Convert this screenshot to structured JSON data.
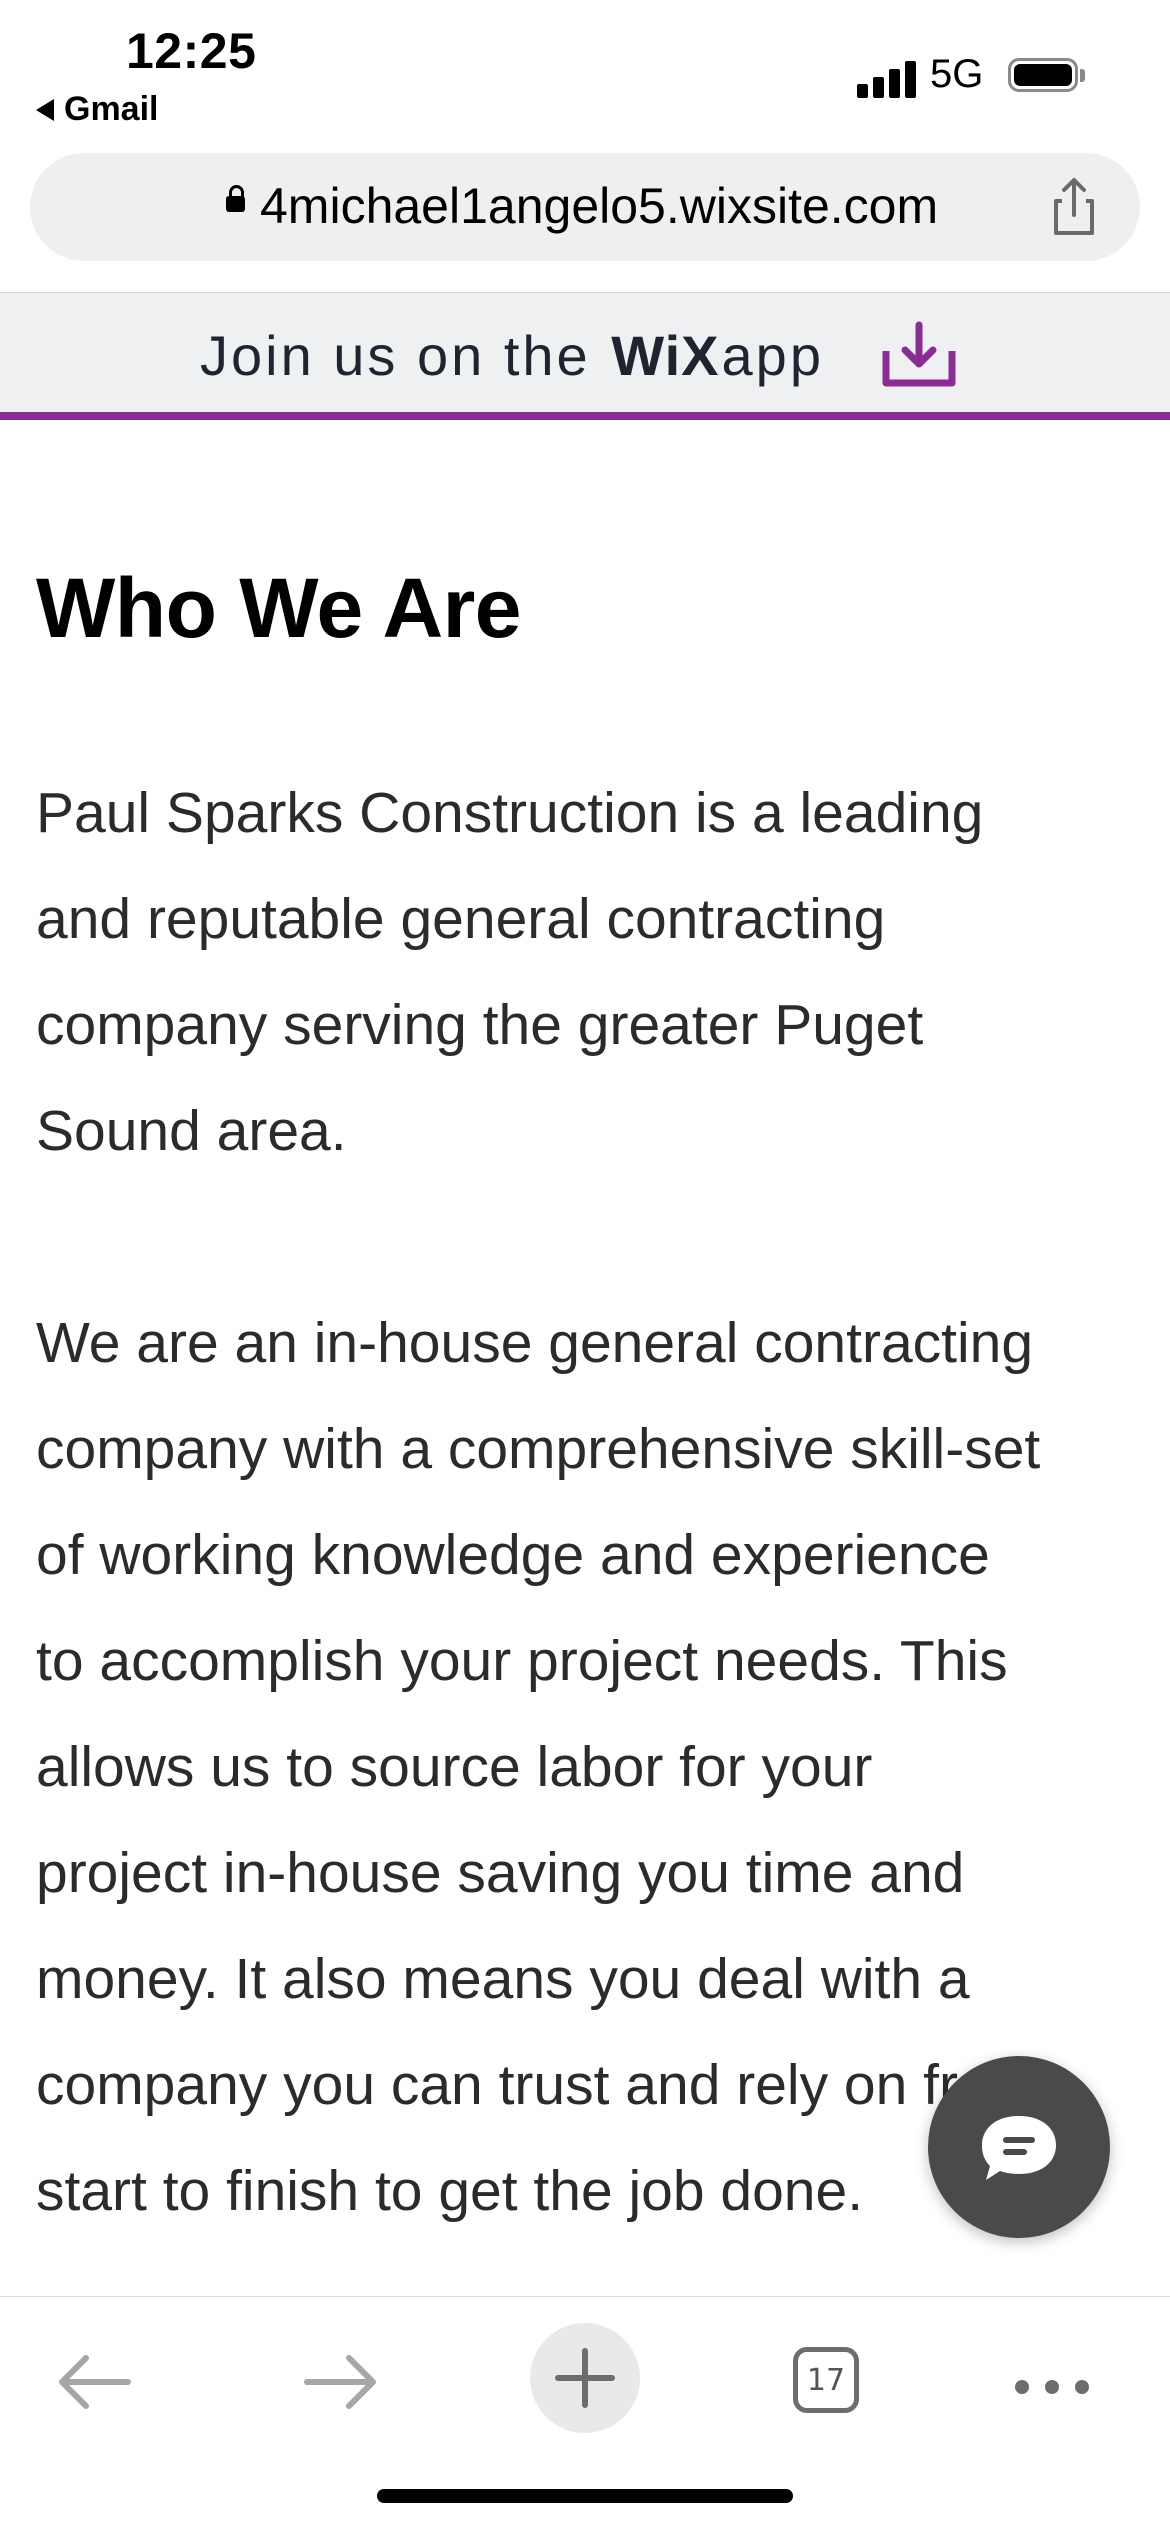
{
  "status_bar": {
    "time": "12:25",
    "back_app": "Gmail",
    "network": "5G",
    "signal_icon": "signal-bars-icon",
    "battery_icon": "battery-icon"
  },
  "url_bar": {
    "url": "4michael1angelo5.wixsite.com",
    "lock_icon": "lock-icon",
    "share_icon": "share-icon"
  },
  "wix_banner": {
    "prefix": "Join us on the",
    "logo": "WiX",
    "suffix": "app",
    "accent_color": "#8b2c95"
  },
  "content": {
    "heading": "Who We Are",
    "paragraph_1": "Paul Sparks Construction is a leading and reputable general contracting company serving the greater Puget Sound area.",
    "paragraph_2": "We are an in-house general contracting company with a comprehensive skill-set of working knowledge and experience to accomplish your project needs. This allows us to source labor for your project in-house saving you time and money. It also means you deal with a company you can trust and rely on from start to finish to get the job done."
  },
  "chat_button": {
    "icon": "chat-icon",
    "color": "#4a4a4a"
  },
  "toolbar": {
    "back_icon": "arrow-left-icon",
    "forward_icon": "arrow-right-icon",
    "new_tab_icon": "plus-icon",
    "tab_count": "17",
    "menu_icon": "more-dots-icon"
  }
}
